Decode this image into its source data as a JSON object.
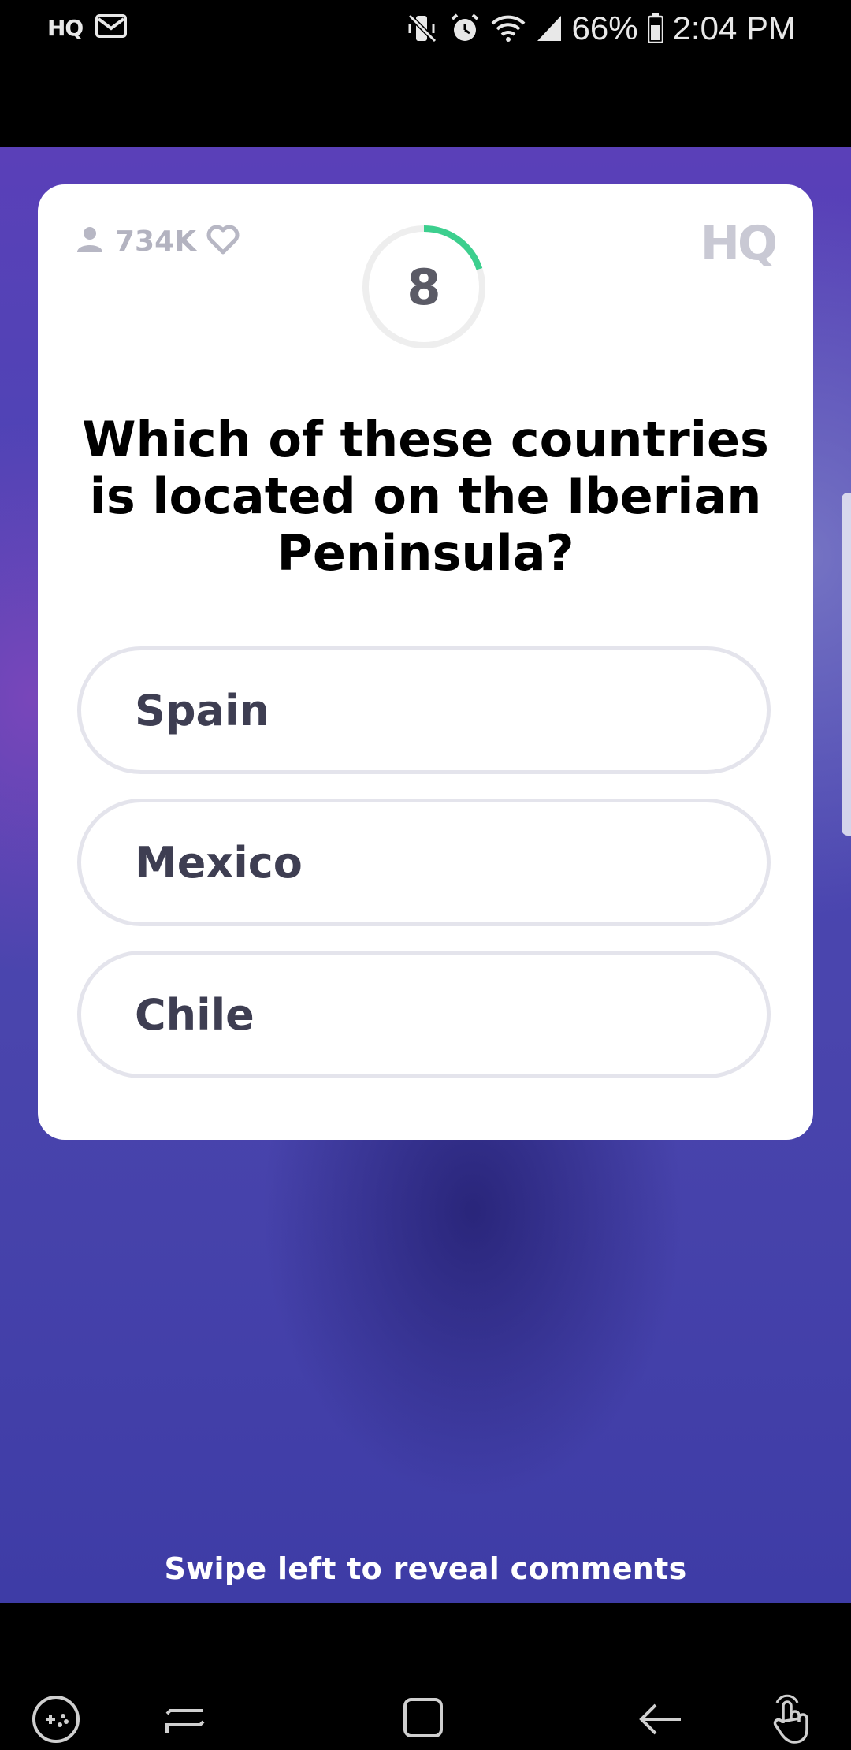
{
  "status_bar": {
    "app_badge": "HQ",
    "battery": "66%",
    "time": "2:04 PM",
    "icons": [
      "mail-icon",
      "mute-icon",
      "alarm-icon",
      "wifi-icon",
      "signal-icon",
      "battery-icon"
    ]
  },
  "card": {
    "viewer_count": "734K",
    "logo": "HQ",
    "timer": {
      "seconds": "8",
      "progress": 0.2
    },
    "question": "Which of these countries is located on the Iberian Peninsula?",
    "answers": [
      {
        "label": "Spain"
      },
      {
        "label": "Mexico"
      },
      {
        "label": "Chile"
      }
    ]
  },
  "swipe_hint": "Swipe left to reveal comments",
  "nav_bar": {
    "icons": [
      "game-tools-icon",
      "recent-apps-icon",
      "home-icon",
      "back-icon",
      "touch-gesture-icon"
    ]
  },
  "colors": {
    "timer_accent": "#3ccf8e",
    "card_background": "#ffffff",
    "video_background": "#4a45ad"
  }
}
